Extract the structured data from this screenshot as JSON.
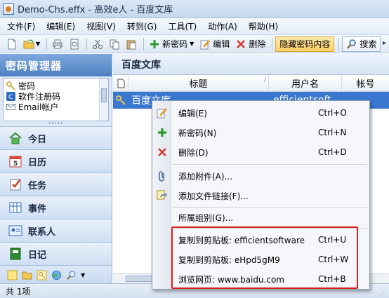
{
  "window": {
    "title": "Demo-Chs.effx - 高效e人 - 百度文库"
  },
  "menubar": {
    "items": [
      "文件(F)",
      "编辑(E)",
      "视图(V)",
      "转到(G)",
      "工具(T)",
      "动作(A)",
      "帮助(H)"
    ]
  },
  "toolbar": {
    "new_password": "新密码",
    "edit": "编辑",
    "delete": "删除",
    "hide_password": "隐藏密码内容",
    "search": "搜索"
  },
  "sidebar": {
    "title": "密码管理器",
    "tree": [
      "密码",
      "软件注册码",
      "Email帐户"
    ],
    "nav": [
      "今日",
      "日历",
      "任务",
      "事件",
      "联系人",
      "日记"
    ]
  },
  "main": {
    "title": "百度文库",
    "columns": [
      "标题",
      "用户名",
      "帐号"
    ],
    "row": {
      "title": "百度文库",
      "username": "efficientsoft"
    }
  },
  "context_menu": {
    "items": [
      {
        "label": "编辑(E)",
        "shortcut": "Ctrl+O",
        "icon": "edit-icon"
      },
      {
        "label": "新密码(N)",
        "shortcut": "Ctrl+N",
        "icon": "plus-icon"
      },
      {
        "label": "删除(D)",
        "shortcut": "Ctrl+D",
        "icon": "delete-icon"
      },
      {
        "label": "添加附件(A)...",
        "shortcut": "",
        "icon": "paperclip-icon"
      },
      {
        "label": "添加文件链接(F)...",
        "shortcut": "",
        "icon": "file-link-icon"
      },
      {
        "label": "所属组别(G)...",
        "shortcut": "",
        "icon": ""
      },
      {
        "label": "复制到剪贴板: efficientsoftware",
        "shortcut": "Ctrl+U",
        "icon": ""
      },
      {
        "label": "复制到剪贴板: eHpd5gM9",
        "shortcut": "Ctrl+W",
        "icon": ""
      },
      {
        "label": "浏览网页: www.baidu.com",
        "shortcut": "Ctrl+B",
        "icon": ""
      }
    ]
  },
  "status": {
    "text": "共 1项"
  },
  "colors": {
    "selection": "#3a78cf",
    "highlight_box": "#e02020",
    "hide_password_button": "#ffcf66"
  }
}
